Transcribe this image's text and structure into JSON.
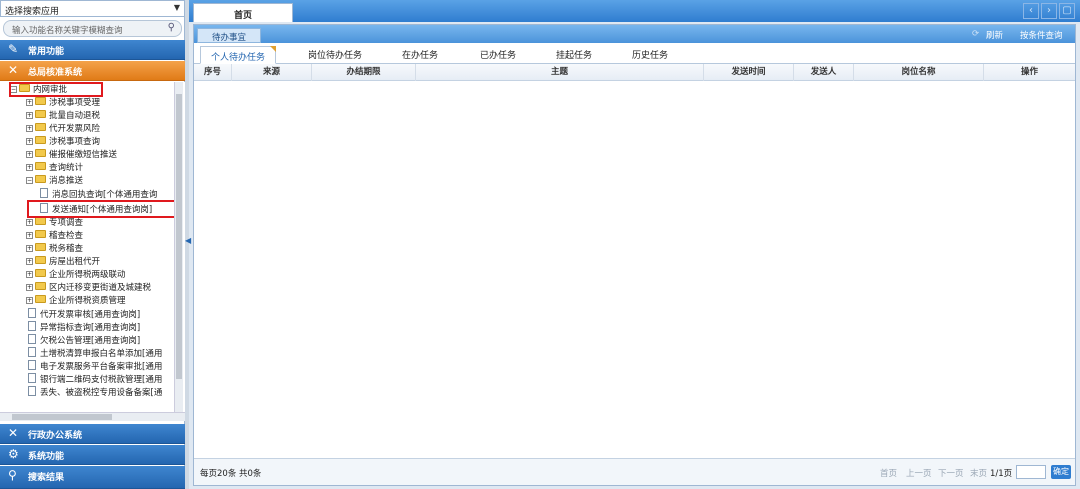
{
  "sidebar": {
    "app_select": "选择搜索应用",
    "search_placeholder": "输入功能名称关键字模糊查询",
    "menu_common": "常用功能",
    "menu_active": "总局核准系统",
    "tree": {
      "root": "内网审批",
      "folders": [
        "涉税事项受理",
        "批量自动退税",
        "代开发票风险",
        "涉税事项查询",
        "催报催缴短信推送",
        "查询统计",
        "消息推送"
      ],
      "msg_children": [
        "消息回执查询[个体通用查询",
        "发送通知[个体通用查询岗]"
      ],
      "folders2": [
        "专项调查",
        "稽查检查",
        "税务稽查",
        "房屋出租代开",
        "企业所得税两级联动",
        "区内迁移变更街道及城建税",
        "企业所得税资质管理"
      ],
      "files": [
        "代开发票审核[通用查询岗]",
        "异常指标查询[通用查询岗]",
        "欠税公告管理[通用查询岗]",
        "土增税清算申报白名单添加[通用",
        "电子发票服务平台备案审批[通用",
        "银行端二维码支付税款管理[通用",
        "丢失、被盗税控专用设备备案[通"
      ]
    },
    "menu_office": "行政办公系统",
    "menu_system": "系统功能",
    "menu_search": "搜索结果"
  },
  "tabs": {
    "home": "首页"
  },
  "panel": {
    "title": "待办事宜",
    "refresh": "刷新",
    "query": "按条件查询",
    "subtabs": [
      "个人待办任务",
      "岗位待办任务",
      "在办任务",
      "已办任务",
      "挂起任务",
      "历史任务"
    ],
    "columns": [
      "序号",
      "来源",
      "办结期限",
      "主题",
      "发送时间",
      "发送人",
      "岗位名称",
      "操作"
    ]
  },
  "footer": {
    "summary": "每页20条 共0条",
    "first": "首页",
    "prev": "上一页",
    "next": "下一页",
    "last": "末页",
    "page": "1/1页",
    "ok": "确定"
  }
}
